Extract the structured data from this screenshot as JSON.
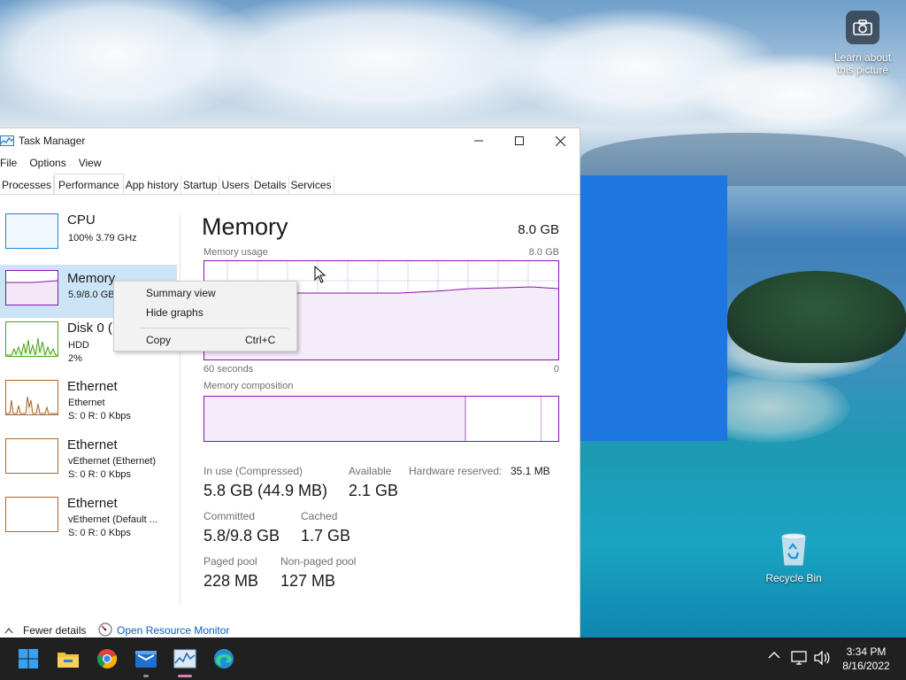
{
  "desktop": {
    "learn_label": "Learn about this picture",
    "recycle_label": "Recycle Bin"
  },
  "window": {
    "title": "Task Manager",
    "menu": [
      "File",
      "Options",
      "View"
    ],
    "tabs": [
      "Processes",
      "Performance",
      "App history",
      "Startup",
      "Users",
      "Details",
      "Services"
    ],
    "active_tab": "Performance"
  },
  "sidebar": {
    "items": [
      {
        "name": "CPU",
        "line1": "100%  3.79 GHz",
        "line2": ""
      },
      {
        "name": "Memory",
        "line1": "5.9/8.0 GB",
        "line2": ""
      },
      {
        "name": "Disk 0 (",
        "line1": "HDD",
        "line2": "2%"
      },
      {
        "name": "Ethernet",
        "line1": "Ethernet",
        "line2": "S: 0  R: 0 Kbps"
      },
      {
        "name": "Ethernet",
        "line1": "vEthernet (Ethernet)",
        "line2": "S: 0  R: 0 Kbps"
      },
      {
        "name": "Ethernet",
        "line1": "vEthernet (Default ...",
        "line2": "S: 0  R: 0 Kbps"
      }
    ]
  },
  "memory": {
    "title": "Memory",
    "total": "8.0 GB",
    "usage_label": "Memory usage",
    "usage_max": "8.0 GB",
    "time_left": "60 seconds",
    "time_right": "0",
    "composition_label": "Memory composition",
    "in_use_label": "In use (Compressed)",
    "in_use_value": "5.8 GB (44.9 MB)",
    "available_label": "Available",
    "available_value": "2.1 GB",
    "hw_reserved_label": "Hardware reserved:",
    "hw_reserved_value": "35.1 MB",
    "committed_label": "Committed",
    "committed_value": "5.8/9.8 GB",
    "cached_label": "Cached",
    "cached_value": "1.7 GB",
    "paged_label": "Paged pool",
    "paged_value": "228 MB",
    "nonpaged_label": "Non-paged pool",
    "nonpaged_value": "127 MB"
  },
  "context_menu": {
    "items": [
      {
        "label": "Summary view",
        "shortcut": ""
      },
      {
        "label": "Hide graphs",
        "shortcut": ""
      },
      {
        "label": "Copy",
        "shortcut": "Ctrl+C"
      }
    ]
  },
  "footer": {
    "fewer_details": "Fewer details",
    "resource_monitor": "Open Resource Monitor"
  },
  "taskbar": {
    "time": "3:34 PM",
    "date": "8/16/2022"
  },
  "colors": {
    "memory_accent": "#8b12ae",
    "selected_bg": "#cce4f7",
    "link": "#0a62b8",
    "taskbar_bg": "#202020"
  }
}
